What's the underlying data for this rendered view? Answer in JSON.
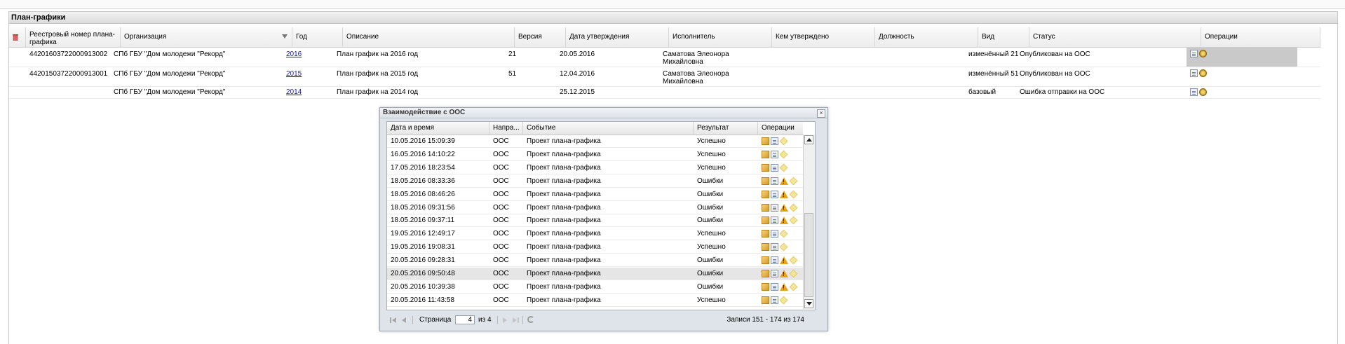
{
  "panel": {
    "title": "План-графики"
  },
  "main_grid": {
    "columns": [
      "Реестровый номер плана-графика",
      "Организация",
      "Год",
      "Описание",
      "Версия",
      "Дата утверждения",
      "Исполнитель",
      "Кем утверждено",
      "Должность",
      "Вид документа",
      "Статус",
      "Операции"
    ],
    "rows": [
      {
        "number": "44201603722000913002",
        "org": "СПб ГБУ \"Дом молодежи \"Рекорд\"",
        "year": "2016",
        "desc": "План график на 2016 год",
        "version": "21",
        "date": "20.05.2016",
        "exec1": "Саматова Элеонора",
        "exec2": "Михайловна",
        "approved_by": "",
        "position": "",
        "doc_type": "изменённый 21",
        "status": "Опубликован на ООС"
      },
      {
        "number": "44201503722000913001",
        "org": "СПб ГБУ \"Дом молодежи \"Рекорд\"",
        "year": "2015",
        "desc": "План график на 2015 год",
        "version": "51",
        "date": "12.04.2016",
        "exec1": "Саматова Элеонора",
        "exec2": "Михайловна",
        "approved_by": "",
        "position": "",
        "doc_type": "изменённый 51",
        "status": "Опубликован на ООС"
      },
      {
        "number": "",
        "org": "СПб ГБУ \"Дом молодежи \"Рекорд\"",
        "year": "2014",
        "desc": "План график на 2014 год",
        "version": "",
        "date": "25.12.2015",
        "exec1": "",
        "exec2": "",
        "approved_by": "",
        "position": "",
        "doc_type": "базовый",
        "status": "Ошибка отправки на ООС"
      }
    ]
  },
  "dialog": {
    "title": "Взаимодействие с ООС",
    "close_label": "×",
    "columns": [
      "Дата и время",
      "Напра...",
      "Событие",
      "Результат",
      "Операции"
    ],
    "rows": [
      {
        "datetime": "10.05.2016 15:09:39",
        "direction": "ООС",
        "event": "Проект плана-графика",
        "result": "Успешно",
        "warning": false
      },
      {
        "datetime": "16.05.2016 14:10:22",
        "direction": "ООС",
        "event": "Проект плана-графика",
        "result": "Успешно",
        "warning": false
      },
      {
        "datetime": "17.05.2016 18:23:54",
        "direction": "ООС",
        "event": "Проект плана-графика",
        "result": "Успешно",
        "warning": false
      },
      {
        "datetime": "18.05.2016 08:33:36",
        "direction": "ООС",
        "event": "Проект плана-графика",
        "result": "Ошибки",
        "warning": true
      },
      {
        "datetime": "18.05.2016 08:46:26",
        "direction": "ООС",
        "event": "Проект плана-графика",
        "result": "Ошибки",
        "warning": true
      },
      {
        "datetime": "18.05.2016 09:31:56",
        "direction": "ООС",
        "event": "Проект плана-графика",
        "result": "Ошибки",
        "warning": true
      },
      {
        "datetime": "18.05.2016 09:37:11",
        "direction": "ООС",
        "event": "Проект плана-графика",
        "result": "Ошибки",
        "warning": true
      },
      {
        "datetime": "19.05.2016 12:49:17",
        "direction": "ООС",
        "event": "Проект плана-графика",
        "result": "Успешно",
        "warning": false
      },
      {
        "datetime": "19.05.2016 19:08:31",
        "direction": "ООС",
        "event": "Проект плана-графика",
        "result": "Успешно",
        "warning": false
      },
      {
        "datetime": "20.05.2016 09:28:31",
        "direction": "ООС",
        "event": "Проект плана-графика",
        "result": "Ошибки",
        "warning": true
      },
      {
        "datetime": "20.05.2016 09:50:48",
        "direction": "ООС",
        "event": "Проект плана-графика",
        "result": "Ошибки",
        "warning": true
      },
      {
        "datetime": "20.05.2016 10:39:38",
        "direction": "ООС",
        "event": "Проект плана-графика",
        "result": "Ошибки",
        "warning": true
      },
      {
        "datetime": "20.05.2016 11:43:58",
        "direction": "ООС",
        "event": "Проект плана-графика",
        "result": "Успешно",
        "warning": false
      }
    ],
    "pager": {
      "page_label": "Страница",
      "page_value": "4",
      "of_label": "из 4",
      "records_label": "Записи 151 - 174 из 174"
    }
  },
  "icons": {
    "trash": "trash-icon",
    "filter": "filter-icon",
    "doc": "document-icon",
    "emblem": "emblem-icon",
    "cube": "package-icon",
    "warning": "warning-icon",
    "star": "sticky-note-icon",
    "refresh": "refresh-icon"
  },
  "colors": {
    "link": "#1a1aa8",
    "selected_row": "#e6e6e6",
    "ops_highlight": "#c9c9c9"
  }
}
